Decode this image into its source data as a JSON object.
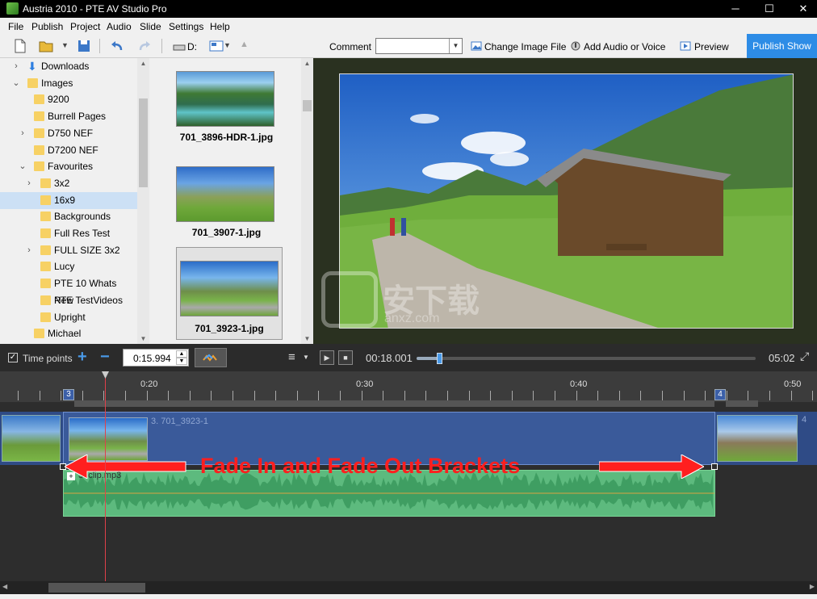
{
  "window": {
    "title": "Austria 2010 - PTE AV Studio Pro",
    "min": "─",
    "max": "☐",
    "close": "✕"
  },
  "menu": [
    "File",
    "Publish",
    "Project",
    "Audio",
    "Slide",
    "Settings",
    "Help"
  ],
  "toolbar": {
    "drive_label": "D:",
    "comment_label": "Comment",
    "comment_value": "",
    "change_image_label": "Change Image File",
    "add_audio_label": "Add Audio or Voice",
    "preview_label": "Preview",
    "publish_label": "Publish Show"
  },
  "tree": [
    {
      "label": "Downloads",
      "expand": "›",
      "indent": 0,
      "special": true
    },
    {
      "label": "Images",
      "expand": "⌄",
      "indent": 0
    },
    {
      "label": "9200",
      "expand": "",
      "indent": 1
    },
    {
      "label": "Burrell Pages",
      "expand": "",
      "indent": 1
    },
    {
      "label": "D750 NEF",
      "expand": "›",
      "indent": 1
    },
    {
      "label": "D7200 NEF",
      "expand": "",
      "indent": 1
    },
    {
      "label": "Favourites",
      "expand": "⌄",
      "indent": 1
    },
    {
      "label": "3x2",
      "expand": "›",
      "indent": 2
    },
    {
      "label": "16x9",
      "expand": "",
      "indent": 2,
      "selected": true
    },
    {
      "label": "Backgrounds",
      "expand": "",
      "indent": 2
    },
    {
      "label": "Full Res Test",
      "expand": "",
      "indent": 2
    },
    {
      "label": "FULL SIZE 3x2",
      "expand": "›",
      "indent": 2
    },
    {
      "label": "Lucy",
      "expand": "",
      "indent": 2
    },
    {
      "label": "PTE 10 Whats New",
      "expand": "",
      "indent": 2
    },
    {
      "label": "PTE TestVideos",
      "expand": "",
      "indent": 2
    },
    {
      "label": "Upright",
      "expand": "",
      "indent": 2
    },
    {
      "label": "Michael",
      "expand": "",
      "indent": 1
    }
  ],
  "thumbnails": [
    {
      "name": "701_3896-HDR-1.jpg"
    },
    {
      "name": "701_3907-1.jpg"
    },
    {
      "name": "701_3923-1.jpg",
      "selected": true
    }
  ],
  "controls": {
    "timepoints_label": "Time points",
    "time_value": "0:15.994",
    "current_time": "00:18.001",
    "total_time": "05:02",
    "progress": 0.067
  },
  "timeline": {
    "ruler_labels": [
      "0:20",
      "0:30",
      "0:40",
      "0:50"
    ],
    "marker_left": "3",
    "marker_right": "4",
    "slide_label": "3. 701_3923-1",
    "next_slide_label": "4",
    "audio_label": "3. clip.mp3",
    "annotation": "Fade In and Fade Out Brackets"
  },
  "watermark": {
    "text": "安下载",
    "sub": "anxz.com"
  },
  "colors": {
    "accent": "#2d8ce6",
    "slide_track": "#2f4b86",
    "audio_track": "#5dba7e",
    "annotation": "#ff1f1f",
    "playhead": "#e0404a"
  }
}
